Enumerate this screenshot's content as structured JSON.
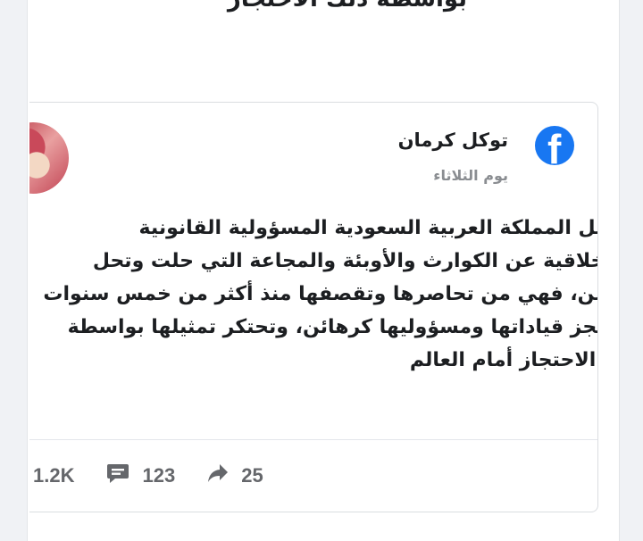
{
  "previous_post": {
    "cut_text": "بواسطة ذلك الاحتجاز"
  },
  "post": {
    "author": "توكل كرمان",
    "timestamp": "يوم الثلاثاء",
    "platform_icon": "facebook-icon",
    "lines": [
      "تتحمل المملكة العربية السعودية المسؤولية القانونية",
      "والاخلاقية عن الكوارث والأوبئة والمجاعة التي حلت وتحل",
      "باليمن، فهي من تحاصرها وتقصفها منذ أكثر من خمس سنوات",
      "وتحتجز قياداتها ومسؤوليها كرهائن، وتحتكر تمثيلها بواسطة",
      "ذلك الاحتجاز أمام العالم"
    ]
  },
  "stats": {
    "likes": "1.2K",
    "comments": "123",
    "shares": "25"
  },
  "colors": {
    "facebook_blue": "#1877f2",
    "text": "#1c1e21",
    "secondary_text": "#65676b",
    "background": "#f0f2f5"
  }
}
